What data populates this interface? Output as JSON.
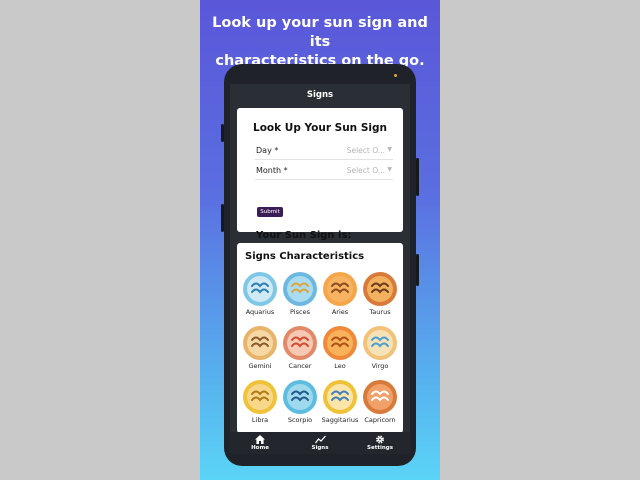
{
  "promo": {
    "line1": "Look up your sun sign and its",
    "line2": "characteristics on the go."
  },
  "appbar": {
    "title": "Signs"
  },
  "lookup": {
    "title": "Look Up Your Sun Sign",
    "day_label": "Day *",
    "day_value": "Select O...",
    "month_label": "Month *",
    "month_value": "Select O...",
    "submit_label": "Submit",
    "result_label": "Your Sun Sign is:"
  },
  "characteristics": {
    "title": "Signs Characteristics",
    "signs": [
      {
        "name": "Aquarius",
        "icon": "aquarius-icon",
        "ring": "#7ec7e6",
        "fill": "#cfeaf5",
        "color": "#2b7fb5"
      },
      {
        "name": "Pisces",
        "icon": "pisces-icon",
        "ring": "#6db8de",
        "fill": "#a9dcf0",
        "color": "#e0a43a"
      },
      {
        "name": "Aries",
        "icon": "aries-icon",
        "ring": "#f5a64a",
        "fill": "#f6b463",
        "color": "#8a4a1f"
      },
      {
        "name": "Taurus",
        "icon": "taurus-icon",
        "ring": "#d97a3a",
        "fill": "#f1b15f",
        "color": "#6b3a1c"
      },
      {
        "name": "Gemini",
        "icon": "gemini-icon",
        "ring": "#e8b46a",
        "fill": "#f6d8a5",
        "color": "#8a5a2a"
      },
      {
        "name": "Cancer",
        "icon": "cancer-icon",
        "ring": "#e28a68",
        "fill": "#f5c9b4",
        "color": "#d44a2f"
      },
      {
        "name": "Leo",
        "icon": "leo-icon",
        "ring": "#f08a3a",
        "fill": "#f7b25a",
        "color": "#b05018"
      },
      {
        "name": "Virgo",
        "icon": "virgo-icon",
        "ring": "#f2c27a",
        "fill": "#f6e2b7",
        "color": "#4b9fd0"
      },
      {
        "name": "Libra",
        "icon": "libra-icon",
        "ring": "#f0c23a",
        "fill": "#f7d88a",
        "color": "#b07a18"
      },
      {
        "name": "Scorpio",
        "icon": "scorpio-icon",
        "ring": "#5dbde0",
        "fill": "#9fd9ee",
        "color": "#1f5a8a"
      },
      {
        "name": "Saggitarius",
        "icon": "sagittarius-icon",
        "ring": "#f0c23a",
        "fill": "#fbe5a8",
        "color": "#3f7fc0"
      },
      {
        "name": "Capricorn",
        "icon": "capricorn-icon",
        "ring": "#d87a3a",
        "fill": "#f0a068",
        "color": "#ffffff"
      }
    ]
  },
  "bottom_nav": {
    "home": {
      "label": "Home",
      "icon": "home-icon"
    },
    "signs": {
      "label": "Signs",
      "icon": "chart-line-icon"
    },
    "settings": {
      "label": "Settings",
      "icon": "gear-icon"
    }
  }
}
